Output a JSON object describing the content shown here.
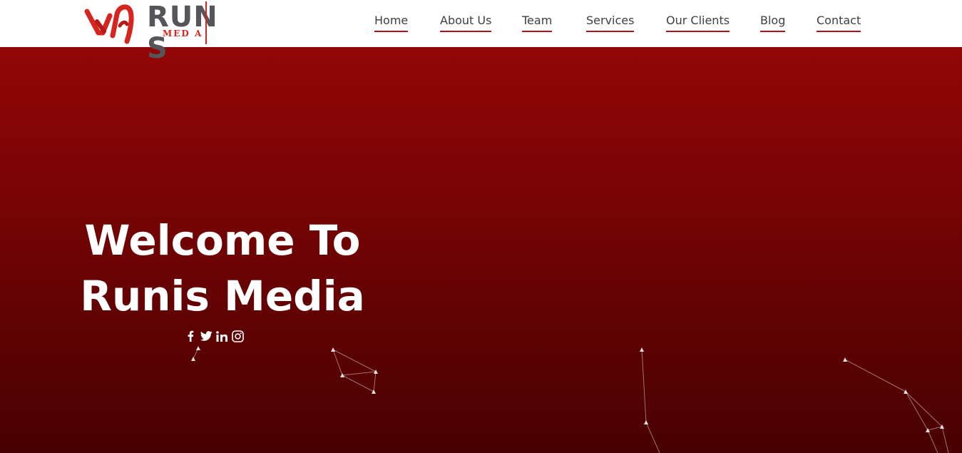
{
  "brand": {
    "logo_text": "RUN S",
    "logo_sub": "MED A",
    "accent_color": "#d6251e",
    "text_color": "#54565a"
  },
  "nav": {
    "items": [
      {
        "label": "Home"
      },
      {
        "label": "About Us"
      },
      {
        "label": "Team"
      },
      {
        "label": "Services"
      },
      {
        "label": "Our Clients"
      },
      {
        "label": "Blog"
      },
      {
        "label": "Contact"
      }
    ],
    "underline_color": "#b3121a"
  },
  "hero": {
    "title_line1": "Welcome To",
    "title_line2": "Runis Media",
    "gradient_top": "#930607",
    "gradient_bottom": "#480102"
  },
  "socials": [
    {
      "icon": "facebook-icon"
    },
    {
      "icon": "twitter-icon"
    },
    {
      "icon": "linkedin-icon"
    },
    {
      "icon": "instagram-icon"
    }
  ]
}
